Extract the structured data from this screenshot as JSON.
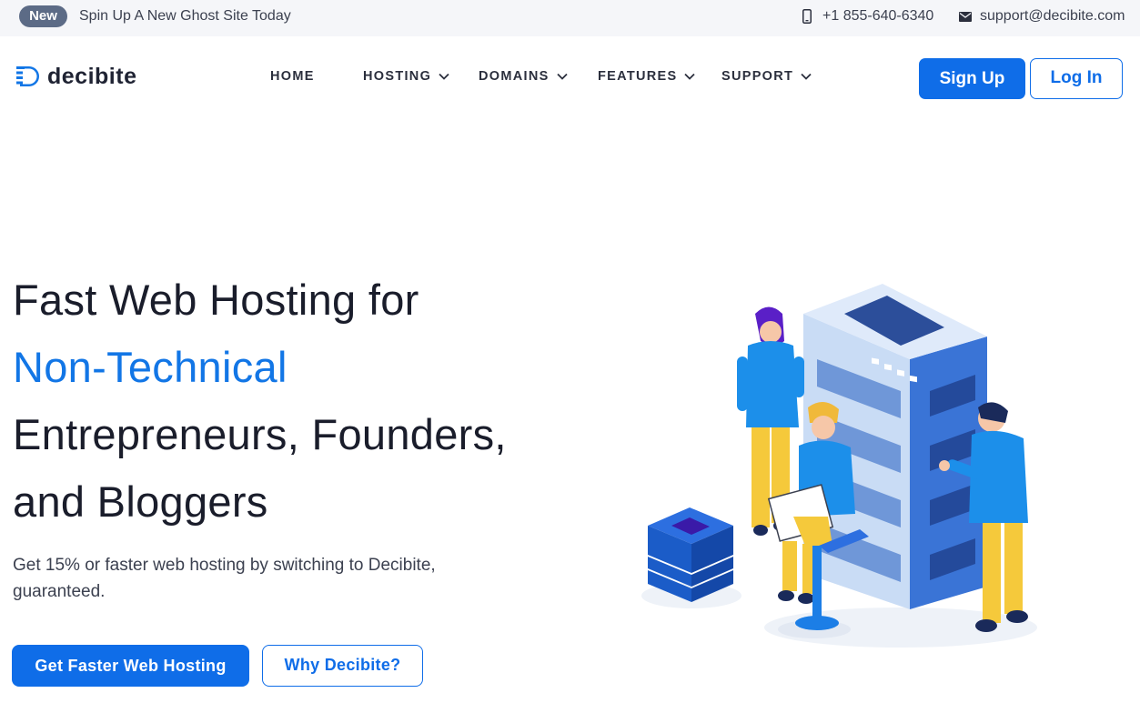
{
  "topbar": {
    "badge": "New",
    "promo": "Spin Up A New Ghost Site Today",
    "phone": "+1 855-640-6340",
    "email": "support@decibite.com"
  },
  "header": {
    "logo_text": "decibite",
    "nav": [
      {
        "label": "HOME",
        "dropdown": false
      },
      {
        "label": "HOSTING",
        "dropdown": true
      },
      {
        "label": "DOMAINS",
        "dropdown": true
      },
      {
        "label": "FEATURES",
        "dropdown": true
      },
      {
        "label": "SUPPORT",
        "dropdown": true
      }
    ],
    "signup_label": "Sign Up",
    "login_label": "Log In"
  },
  "hero": {
    "line1": "Fast Web Hosting for",
    "line2": "Non-Technical",
    "line3": "Entrepreneurs, Founders,",
    "line4": "and Bloggers",
    "subtitle": "Get 15% or faster web hosting by switching to Decibite, guaranteed.",
    "primary_cta": "Get Faster Web Hosting",
    "secondary_cta": "Why Decibite?"
  },
  "colors": {
    "accent": "#0f6de8",
    "badge": "#5c6b86",
    "topbar_bg": "#f5f6f9",
    "text": "#1a1d2b"
  },
  "icons": {
    "phone": "phone-icon",
    "email": "mail-icon",
    "chevron": "chevron-down-icon",
    "logo": "logo-icon"
  }
}
